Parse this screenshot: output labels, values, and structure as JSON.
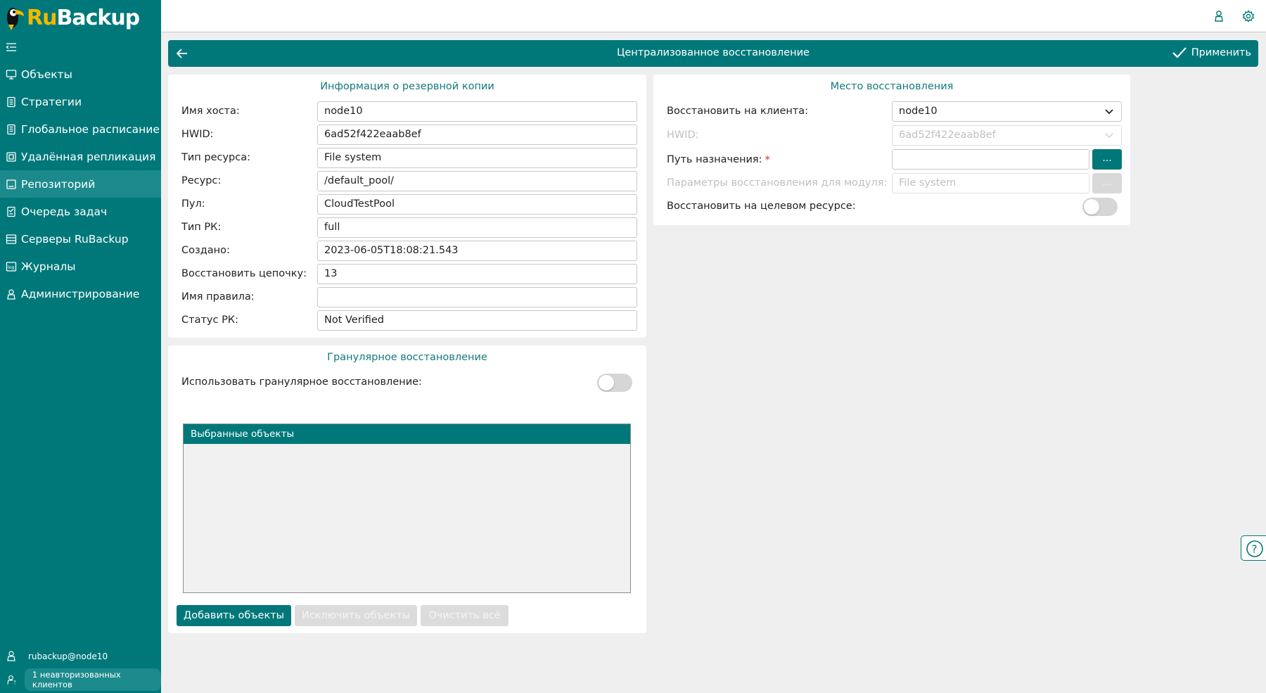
{
  "brand": {
    "name_ru": "Ru",
    "name_rest": "Backup"
  },
  "sidebar": {
    "items": [
      {
        "label": "Объекты",
        "icon": "monitor-icon"
      },
      {
        "label": "Стратегии",
        "icon": "document-icon"
      },
      {
        "label": "Глобальное расписание",
        "icon": "calendar-icon"
      },
      {
        "label": "Удалённая репликация",
        "icon": "replication-icon"
      },
      {
        "label": "Репозиторий",
        "icon": "repository-icon",
        "active": true
      },
      {
        "label": "Очередь задач",
        "icon": "tasks-icon"
      },
      {
        "label": "Серверы RuBackup",
        "icon": "server-icon"
      },
      {
        "label": "Журналы",
        "icon": "log-icon"
      },
      {
        "label": "Администрирование",
        "icon": "admin-icon"
      }
    ],
    "user": "rubackup@node10",
    "unauthorized": "1 неавторизованных клиентов"
  },
  "header": {
    "title": "Централизованное восстановление",
    "apply_label": "Применить"
  },
  "backup_info": {
    "title": "Информация о резервной копии",
    "fields": [
      {
        "label": "Имя хоста:",
        "value": "node10"
      },
      {
        "label": "HWID:",
        "value": "6ad52f422eaab8ef"
      },
      {
        "label": "Тип ресурса:",
        "value": "File system"
      },
      {
        "label": "Ресурс:",
        "value": "/default_pool/"
      },
      {
        "label": "Пул:",
        "value": "CloudTestPool"
      },
      {
        "label": "Тип РК:",
        "value": "full"
      },
      {
        "label": "Создано:",
        "value": "2023-06-05T18:08:21.543"
      },
      {
        "label": "Восстановить цепочку:",
        "value": "13"
      },
      {
        "label": "Имя правила:",
        "value": ""
      },
      {
        "label": "Статус РК:",
        "value": "Not Verified"
      }
    ]
  },
  "granular": {
    "title": "Гранулярное восстановление",
    "toggle_label": "Использовать гранулярное восстановление:",
    "toggle_on": false,
    "table_header": "Выбранные объекты",
    "buttons": {
      "add": "Добавить объекты",
      "exclude": "Исключить объекты",
      "clear": "Очистить всё"
    }
  },
  "restore_location": {
    "title": "Место восстановления",
    "client_label": "Восстановить на клиента:",
    "client_value": "node10",
    "hwid_label": "HWID:",
    "hwid_value": "6ad52f422eaab8ef",
    "path_label": "Путь назначения:",
    "required_mark": "*",
    "path_value": "",
    "module_params_label": "Параметры восстановления для модуля:",
    "module_params_value": "File system",
    "browse_label": "...",
    "target_label": "Восстановить на целевом ресурсе:",
    "target_on": false
  },
  "colors": {
    "accent": "#00787a",
    "active_item": "#1c8a8c",
    "logo_yellow": "#f5b800"
  }
}
